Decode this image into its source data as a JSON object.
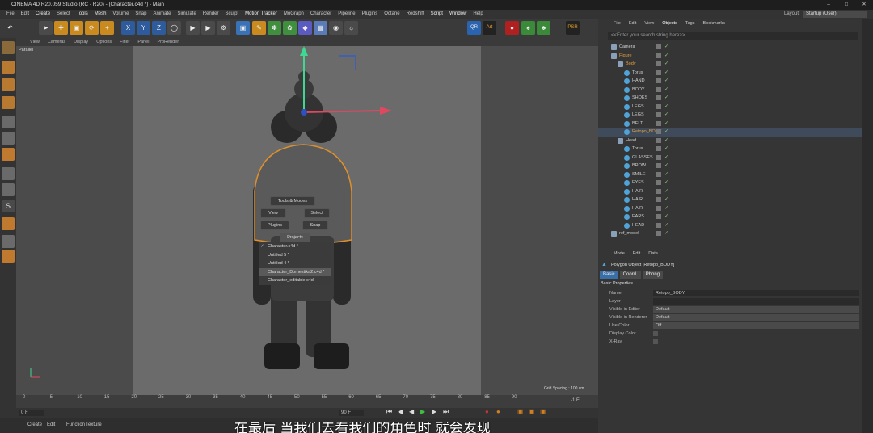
{
  "window": {
    "title": "CINEMA 4D R20.059 Studio (RC - R20) - [Character.c4d *] - Main"
  },
  "menu": [
    "File",
    "Edit",
    "Create",
    "Select",
    "Tools",
    "Mesh",
    "Volume",
    "Snap",
    "Animate",
    "Simulate",
    "Render",
    "Sculpt",
    "Motion Tracker",
    "MoGraph",
    "Character",
    "Pipeline",
    "Plugins",
    "Octane",
    "Redshift",
    "Script",
    "Window",
    "Help"
  ],
  "layout": {
    "label": "Layout:",
    "value": "Startup (User)"
  },
  "viewport": {
    "menu": [
      "View",
      "Cameras",
      "Display",
      "Options",
      "Filter",
      "Panel",
      "ProRender"
    ],
    "camera_label": "Parallel",
    "grid_spacing": "Grid Spacing : 100 cm"
  },
  "popup": {
    "tools_modes": "Tools & Modes",
    "view": "View",
    "select": "Select",
    "plugins": "Plugins",
    "snap": "Snap",
    "projects": "Projects",
    "project_list": [
      "Character.c4d *",
      "Untitled 5 *",
      "Untitled 4 *",
      "Character_Domestika2.c4d *",
      "Character_editable.c4d"
    ]
  },
  "timeline": {
    "ticks": [
      "0",
      "5",
      "10",
      "15",
      "20",
      "25",
      "30",
      "35",
      "40",
      "45",
      "50",
      "55",
      "60",
      "65",
      "70",
      "75",
      "80",
      "85",
      "90"
    ],
    "current_frame": "0 F",
    "start": "0 F",
    "end": "90 F",
    "end2": "90 F",
    "right_label": "-1 F"
  },
  "bottom_menu": [
    "Create",
    "Edit",
    "Function",
    "Texture"
  ],
  "object_manager": {
    "menu": [
      "File",
      "Edit",
      "View",
      "Objects",
      "Tags",
      "Bookmarks"
    ],
    "search_placeholder": "<<Enter your search string here>>",
    "objects": [
      {
        "name": "Camera",
        "indent": 0
      },
      {
        "name": "Figure",
        "indent": 0
      },
      {
        "name": "Body",
        "indent": 1
      },
      {
        "name": "Torus",
        "indent": 2
      },
      {
        "name": "HAND",
        "indent": 2
      },
      {
        "name": "BODY",
        "indent": 2
      },
      {
        "name": "SHOES",
        "indent": 2
      },
      {
        "name": "LEGS",
        "indent": 2
      },
      {
        "name": "LEGS",
        "indent": 2
      },
      {
        "name": "BELT",
        "indent": 2
      },
      {
        "name": "Retopo_BODY",
        "indent": 2
      },
      {
        "name": "Head",
        "indent": 1
      },
      {
        "name": "Torus",
        "indent": 2
      },
      {
        "name": "GLASSES",
        "indent": 2
      },
      {
        "name": "BROW",
        "indent": 2
      },
      {
        "name": "SMILE",
        "indent": 2
      },
      {
        "name": "EYES",
        "indent": 2
      },
      {
        "name": "HAIR",
        "indent": 2
      },
      {
        "name": "HAIR",
        "indent": 2
      },
      {
        "name": "HAIR",
        "indent": 2
      },
      {
        "name": "EARS",
        "indent": 2
      },
      {
        "name": "HEAD",
        "indent": 2
      },
      {
        "name": "ref_model",
        "indent": 0
      }
    ]
  },
  "attributes": {
    "menu": [
      "Mode",
      "Edit",
      "Data"
    ],
    "object_title": "Polygon Object [Retopo_BODY]",
    "tabs": [
      "Basic",
      "Coord.",
      "Phong"
    ],
    "section": "Basic Properties",
    "rows": [
      {
        "label": "Name",
        "value": "Retopo_BODY"
      },
      {
        "label": "Layer",
        "value": ""
      },
      {
        "label": "Visible in Editor",
        "value": "Default"
      },
      {
        "label": "Visible in Renderer",
        "value": "Default"
      },
      {
        "label": "Use Color",
        "value": "Off"
      },
      {
        "label": "Display Color",
        "value": ""
      },
      {
        "label": "X-Ray",
        "value": ""
      }
    ]
  },
  "subtitle": "在最后 当我们去看我们的角色时 就会发现"
}
